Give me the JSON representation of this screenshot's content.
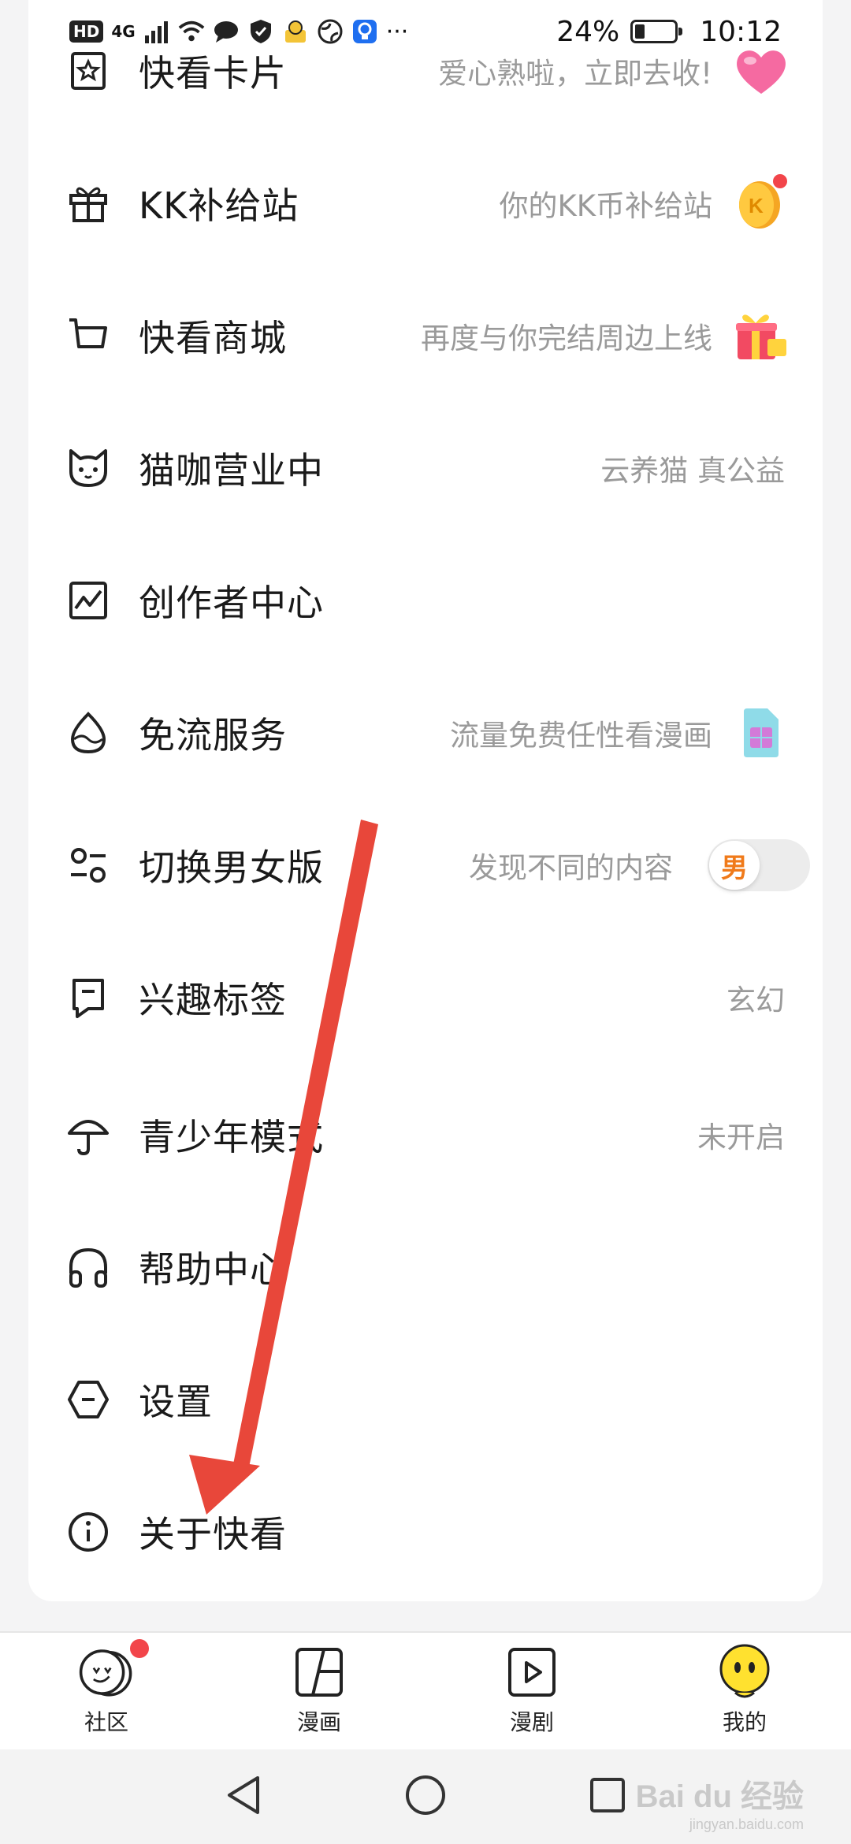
{
  "status_bar": {
    "hd": "HD",
    "network": "4G",
    "battery_percent": "24%",
    "battery_level": 0.24,
    "time": "10:12",
    "more": "···"
  },
  "menu": {
    "items": [
      {
        "label": "快看卡片",
        "hint": "爱心熟啦，立即去收!",
        "icon": "card-star-icon",
        "pic": "heart"
      },
      {
        "label": "KK补给站",
        "hint": "你的KK币补给站",
        "icon": "gift-icon",
        "pic": "coin"
      },
      {
        "label": "快看商城",
        "hint": "再度与你完结周边上线",
        "icon": "cart-icon",
        "pic": "present"
      },
      {
        "label": "猫咖营业中",
        "hint": "云养猫 真公益",
        "icon": "cat-icon",
        "pic": ""
      },
      {
        "label": "创作者中心",
        "hint": "",
        "icon": "chart-icon",
        "pic": ""
      },
      {
        "label": "免流服务",
        "hint": "流量免费任性看漫画",
        "icon": "drop-icon",
        "pic": "sim"
      },
      {
        "label": "切换男女版",
        "hint": "发现不同的内容",
        "icon": "switch-icon",
        "pic": "toggle"
      },
      {
        "label": "兴趣标签",
        "hint": "玄幻",
        "icon": "tag-icon",
        "pic": ""
      },
      {
        "label": "青少年模式",
        "hint": "未开启",
        "icon": "umbrella-icon",
        "pic": ""
      },
      {
        "label": "帮助中心",
        "hint": "",
        "icon": "headphones-icon",
        "pic": ""
      },
      {
        "label": "设置",
        "hint": "",
        "icon": "settings-icon",
        "pic": ""
      },
      {
        "label": "关于快看",
        "hint": "",
        "icon": "info-icon",
        "pic": ""
      }
    ],
    "gender_toggle": "男"
  },
  "tabbar": {
    "tabs": [
      {
        "label": "社区",
        "icon": "community-icon"
      },
      {
        "label": "漫画",
        "icon": "comic-icon"
      },
      {
        "label": "漫剧",
        "icon": "play-icon"
      },
      {
        "label": "我的",
        "icon": "profile-face-icon"
      }
    ]
  },
  "watermark": {
    "text": "Bai du 经验",
    "sub": "jingyan.baidu.com"
  },
  "colors": {
    "accent_arrow": "#e8473a",
    "toggle_text": "#f07a1a",
    "red_dot": "#f2454a",
    "hint": "#9a9a9a"
  }
}
